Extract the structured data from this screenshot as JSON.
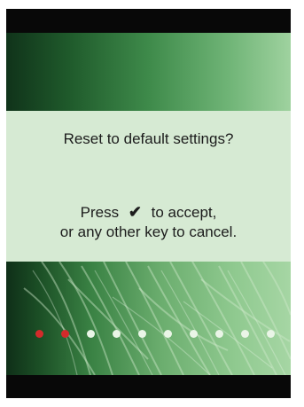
{
  "dialog": {
    "question": "Reset to default settings?",
    "press_text": "Press",
    "check_glyph": "✔",
    "accept_text": "to accept,",
    "cancel_line": "or any other key to cancel."
  },
  "progress": {
    "total_steps": 10,
    "active_steps": 2,
    "colors": {
      "active": "#d42b2b",
      "inactive": "#eaf5e7"
    }
  }
}
